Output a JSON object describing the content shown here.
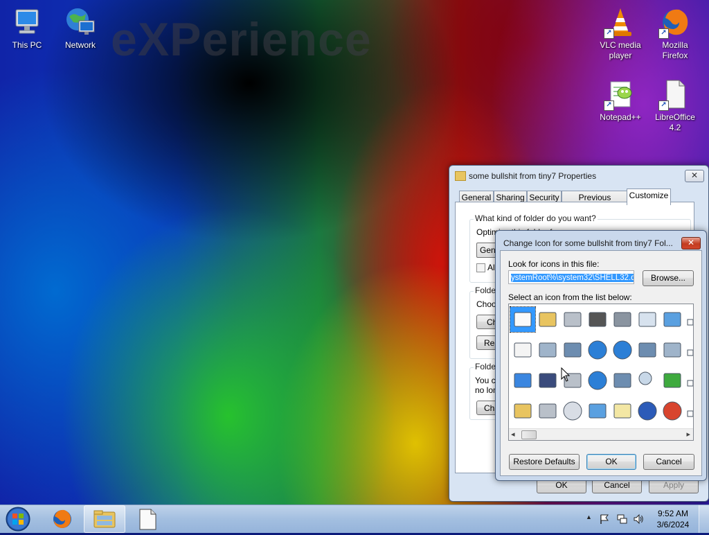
{
  "wallpaper": {
    "logo_text": "eXPerience"
  },
  "desktop_icons": [
    {
      "label": "This PC",
      "icon": "computer-icon"
    },
    {
      "label": "Network",
      "icon": "network-icon"
    },
    {
      "label": "VLC media player",
      "icon": "vlc-icon"
    },
    {
      "label": "Mozilla Firefox",
      "icon": "firefox-icon"
    },
    {
      "label": "Notepad++",
      "icon": "notepad-plus-plus-icon"
    },
    {
      "label": "LibreOffice 4.2",
      "icon": "libreoffice-icon"
    }
  ],
  "properties_window": {
    "title": "some bullshit from tiny7 Properties",
    "close_label": "✕",
    "tabs": [
      "General",
      "Sharing",
      "Security",
      "Previous Versions",
      "Customize"
    ],
    "active_tab": "Customize",
    "group1_label": "What kind of folder do you want?",
    "optimize_label": "Optimize this folder for:",
    "optimize_select_value": "Gene",
    "also_apply_label": "Als",
    "group2_label": "Folder",
    "choose_label": "Choos",
    "choose_button": "Ch",
    "restore_button": "Res",
    "group3_label": "Folder",
    "folder_text_1": "You c",
    "folder_text_2": "no lon",
    "change_button": "Cha",
    "ok_button": "OK",
    "cancel_button": "Cancel",
    "apply_button": "Apply"
  },
  "change_icon_dialog": {
    "title": "Change Icon for some bullshit from tiny7 Fol...",
    "close_label": "✕",
    "look_label": "Look for icons in this file:",
    "file_path": "ystemRoot%\\system32\\SHELL32.dll",
    "browse_button": "Browse...",
    "select_label": "Select an icon from the list below:",
    "restore_defaults_button": "Restore Defaults",
    "ok_button": "OK",
    "cancel_button": "Cancel",
    "scroll_left": "◂",
    "scroll_right": "▸",
    "icons": [
      "blank-window-icon",
      "folder-icon",
      "drive-icon",
      "chip-icon",
      "printer-icon",
      "clock-document-icon",
      "monitor-icon",
      "shortcut-icon",
      "document-icon",
      "computer-printer-icon",
      "network-drive-icon",
      "globe-icon",
      "globe-computer-icon",
      "network-monitor-icon",
      "computer-box-icon",
      "shortcut-arrow-icon",
      "window-icon",
      "floppy-drive-icon",
      "drive-disconnected-icon",
      "globe-mouse-icon",
      "network-computers-icon",
      "search-icon",
      "green-arrow-drive-icon",
      "small-icon",
      "folder-icon",
      "drive-icon",
      "cd-drive-icon",
      "monitor-computer-icon",
      "grid-folder-icon",
      "help-icon",
      "shutdown-icon",
      "small-icon"
    ]
  },
  "taskbar": {
    "start_icon": "windows-start-icon",
    "pinned": [
      {
        "icon": "firefox-icon",
        "active": false
      },
      {
        "icon": "explorer-folder-icon",
        "active": true
      },
      {
        "icon": "document-icon",
        "active": false
      }
    ],
    "tray": {
      "show_hidden_icon": "▲",
      "time": "9:52 AM",
      "date": "3/6/2024"
    }
  }
}
